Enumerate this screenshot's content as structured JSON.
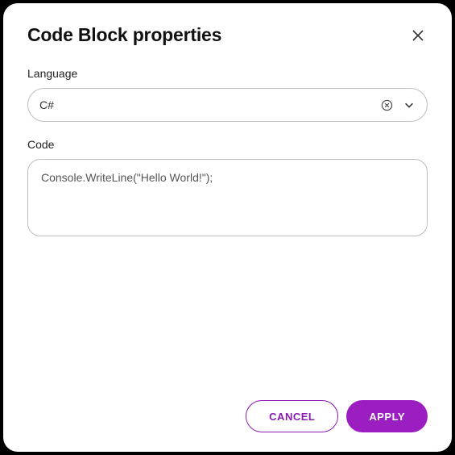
{
  "dialog": {
    "title": "Code Block properties",
    "fields": {
      "language": {
        "label": "Language",
        "value": "C#"
      },
      "code": {
        "label": "Code",
        "value": "Console.WriteLine(\"Hello World!\");"
      }
    },
    "actions": {
      "cancel": "CANCEL",
      "apply": "APPLY"
    }
  }
}
